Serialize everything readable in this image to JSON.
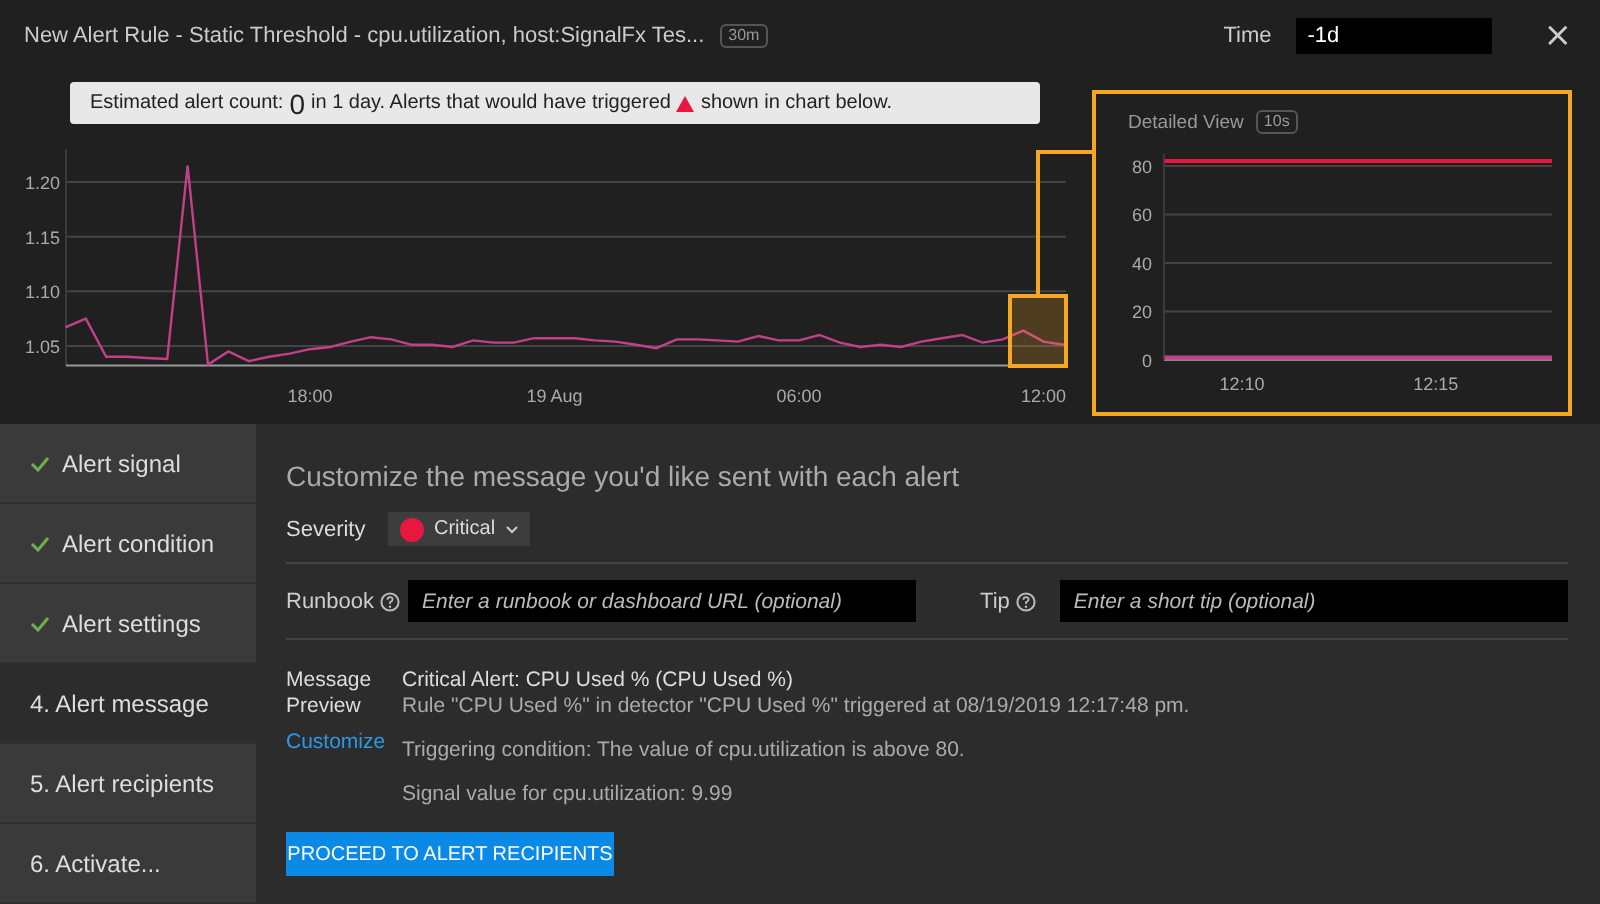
{
  "header": {
    "title": "New Alert Rule - Static Threshold - cpu.utilization, host:SignalFx Tes...",
    "resolution": "30m",
    "time_label": "Time",
    "time_value": "-1d",
    "close": "×"
  },
  "banner": {
    "before": "Estimated alert count:",
    "count": "0",
    "middle": "in 1 day. Alerts that would have triggered",
    "after": "shown in chart below."
  },
  "main_chart": {
    "chart_data": {
      "type": "line",
      "categories": [
        null,
        null,
        null,
        null,
        null,
        null,
        null,
        null,
        null,
        null,
        null,
        null,
        "18:00",
        null,
        null,
        null,
        null,
        null,
        null,
        null,
        null,
        null,
        null,
        null,
        "19 Aug",
        null,
        null,
        null,
        null,
        null,
        null,
        null,
        null,
        null,
        null,
        null,
        "06:00",
        null,
        null,
        null,
        null,
        null,
        null,
        null,
        null,
        null,
        null,
        null,
        "12:00",
        null
      ],
      "series": [
        {
          "color": "#c2408a",
          "values": [
            1.067,
            1.075,
            1.04,
            1.04,
            1.039,
            1.038,
            1.215,
            1.033,
            1.045,
            1.036,
            1.04,
            1.043,
            1.047,
            1.049,
            1.054,
            1.058,
            1.056,
            1.051,
            1.051,
            1.049,
            1.055,
            1.053,
            1.053,
            1.057,
            1.057,
            1.057,
            1.055,
            1.054,
            1.051,
            1.048,
            1.056,
            1.056,
            1.055,
            1.054,
            1.059,
            1.055,
            1.055,
            1.06,
            1.053,
            1.049,
            1.051,
            1.049,
            1.054,
            1.057,
            1.06,
            1.053,
            1.056,
            1.064,
            1.054,
            1.051
          ]
        }
      ],
      "ylim": [
        1.032,
        1.23
      ],
      "grid": true,
      "yticks": [
        {
          "value": 1.05,
          "label": "1.05"
        },
        {
          "value": 1.1,
          "label": "1.10"
        },
        {
          "value": 1.15,
          "label": "1.15"
        },
        {
          "value": 1.2,
          "label": "1.20"
        }
      ]
    }
  },
  "detail": {
    "title": "Detailed View",
    "resolution": "10s",
    "chart_data": {
      "type": "line",
      "categories": [
        null,
        null,
        "12:10",
        null,
        null,
        null,
        null,
        "12:15",
        null,
        null,
        null
      ],
      "series": [
        {
          "color": "#e8173f",
          "values": [
            82,
            82,
            82,
            82,
            82,
            82,
            82,
            82,
            82,
            82,
            82
          ]
        },
        {
          "color": "#c2408a",
          "values": [
            1,
            1,
            1,
            1,
            1,
            1,
            1,
            1,
            1,
            1,
            1
          ]
        }
      ],
      "ylim": [
        0,
        85
      ],
      "grid": true,
      "yticks": [
        {
          "value": 0,
          "label": "0"
        },
        {
          "value": 20,
          "label": "20"
        },
        {
          "value": 40,
          "label": "40"
        },
        {
          "value": 60,
          "label": "60"
        },
        {
          "value": 80,
          "label": "80"
        }
      ]
    }
  },
  "steps": [
    {
      "label": "Alert signal",
      "completed": true,
      "selected": false
    },
    {
      "label": "Alert condition",
      "completed": true,
      "selected": false
    },
    {
      "label": "Alert settings",
      "completed": true,
      "selected": false
    },
    {
      "label": "4. Alert message",
      "completed": false,
      "selected": true
    },
    {
      "label": "5. Alert recipients",
      "completed": false,
      "selected": false
    },
    {
      "label": "6. Activate...",
      "completed": false,
      "selected": false
    }
  ],
  "form": {
    "heading": "Customize the message you'd like sent with each alert",
    "severity": {
      "label": "Severity",
      "value": "Critical",
      "color": "#e8173f"
    },
    "runbook": {
      "label": "Runbook",
      "placeholder": "Enter a runbook or dashboard URL (optional)"
    },
    "tip": {
      "label": "Tip",
      "placeholder": "Enter a short tip (optional)"
    },
    "preview": {
      "label": "Message Preview",
      "customize": "Customize",
      "subject": "Critical Alert: CPU Used % (CPU Used %)",
      "lines": [
        "Rule \"CPU Used %\" in detector \"CPU Used %\" triggered at 08/19/2019 12:17:48 pm.",
        "Triggering condition: The value of cpu.utilization is above 80.",
        "Signal value for cpu.utilization: 9.99"
      ]
    },
    "button": "PROCEED TO ALERT RECIPIENTS"
  }
}
